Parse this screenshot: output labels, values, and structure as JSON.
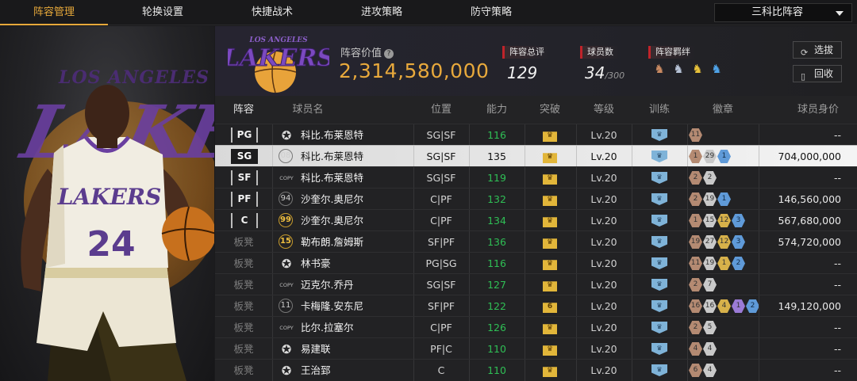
{
  "tabs": [
    "阵容管理",
    "轮换设置",
    "快捷战术",
    "进攻策略",
    "防守策略"
  ],
  "lineup_select": "三科比阵容",
  "header": {
    "value_label": "阵容价值",
    "value": "2,314,580,000",
    "rating_label": "阵容总评",
    "rating": "129",
    "count_label": "球员数",
    "count": "34",
    "count_max": "/300",
    "bond_label": "阵容羁绊",
    "btn_select": "选拔",
    "btn_recycle": "回收"
  },
  "columns": [
    "阵容",
    "球员名",
    "位置",
    "能力",
    "突破",
    "等级",
    "训练",
    "徽章",
    "球员身价"
  ],
  "rows": [
    {
      "slot": "PG",
      "mark": "star",
      "name": "科比.布莱恩特",
      "pos": "SG|SF",
      "ability": "116",
      "breakthrough": "",
      "level": "Lv.20",
      "badges": [
        {
          "c": "bronze",
          "t": "11"
        }
      ],
      "worth": "--"
    },
    {
      "slot": "SG",
      "mark": "08",
      "name": "科比.布莱恩特",
      "pos": "SG|SF",
      "ability": "135",
      "breakthrough": "",
      "level": "Lv.20",
      "badges": [
        {
          "c": "bronze",
          "t": "1"
        },
        {
          "c": "silver",
          "t": "29"
        },
        {
          "c": "blue",
          "t": "1"
        }
      ],
      "worth": "704,000,000",
      "selected": true
    },
    {
      "slot": "SF",
      "mark": "COPY",
      "name": "科比.布莱恩特",
      "pos": "SG|SF",
      "ability": "119",
      "breakthrough": "",
      "level": "Lv.20",
      "badges": [
        {
          "c": "bronze",
          "t": "2"
        },
        {
          "c": "silver",
          "t": "2"
        }
      ],
      "worth": "--"
    },
    {
      "slot": "PF",
      "mark": "94",
      "name": "沙奎尔.奥尼尔",
      "pos": "C|PF",
      "ability": "132",
      "breakthrough": "",
      "level": "Lv.20",
      "badges": [
        {
          "c": "bronze",
          "t": "2"
        },
        {
          "c": "silver",
          "t": "19"
        },
        {
          "c": "blue",
          "t": "1"
        }
      ],
      "worth": "146,560,000"
    },
    {
      "slot": "C",
      "mark": "99",
      "name": "沙奎尔.奥尼尔",
      "pos": "C|PF",
      "ability": "134",
      "breakthrough": "",
      "level": "Lv.20",
      "badges": [
        {
          "c": "bronze",
          "t": "1"
        },
        {
          "c": "silver",
          "t": "15"
        },
        {
          "c": "gold",
          "t": "12"
        },
        {
          "c": "blue",
          "t": "3"
        }
      ],
      "worth": "567,680,000"
    },
    {
      "slot": "板凳",
      "mark": "15",
      "name": "勒布朗.詹姆斯",
      "pos": "SF|PF",
      "ability": "136",
      "breakthrough": "",
      "level": "Lv.20",
      "badges": [
        {
          "c": "bronze",
          "t": "19"
        },
        {
          "c": "silver",
          "t": "27"
        },
        {
          "c": "gold",
          "t": "12"
        },
        {
          "c": "blue",
          "t": "3"
        }
      ],
      "worth": "574,720,000"
    },
    {
      "slot": "板凳",
      "mark": "star",
      "name": "林书豪",
      "pos": "PG|SG",
      "ability": "116",
      "breakthrough": "",
      "level": "Lv.20",
      "badges": [
        {
          "c": "bronze",
          "t": "11"
        },
        {
          "c": "silver",
          "t": "19"
        },
        {
          "c": "gold",
          "t": "1"
        },
        {
          "c": "blue",
          "t": "2"
        }
      ],
      "worth": "--"
    },
    {
      "slot": "板凳",
      "mark": "COPY",
      "name": "迈克尔.乔丹",
      "pos": "SG|SF",
      "ability": "127",
      "breakthrough": "",
      "level": "Lv.20",
      "badges": [
        {
          "c": "bronze",
          "t": "2"
        },
        {
          "c": "silver",
          "t": "7"
        }
      ],
      "worth": "--"
    },
    {
      "slot": "板凳",
      "mark": "11",
      "name": "卡梅隆.安东尼",
      "pos": "SF|PF",
      "ability": "122",
      "breakthrough": "6",
      "level": "Lv.20",
      "badges": [
        {
          "c": "bronze",
          "t": "16"
        },
        {
          "c": "silver",
          "t": "16"
        },
        {
          "c": "gold",
          "t": "4"
        },
        {
          "c": "purple",
          "t": "1"
        },
        {
          "c": "blue",
          "t": "2"
        }
      ],
      "worth": "149,120,000"
    },
    {
      "slot": "板凳",
      "mark": "COPY",
      "name": "比尔.拉塞尔",
      "pos": "C|PF",
      "ability": "126",
      "breakthrough": "",
      "level": "Lv.20",
      "badges": [
        {
          "c": "bronze",
          "t": "2"
        },
        {
          "c": "silver",
          "t": "5"
        }
      ],
      "worth": "--"
    },
    {
      "slot": "板凳",
      "mark": "star",
      "name": "易建联",
      "pos": "PF|C",
      "ability": "110",
      "breakthrough": "",
      "level": "Lv.20",
      "badges": [
        {
          "c": "bronze",
          "t": "4"
        },
        {
          "c": "silver",
          "t": "4"
        }
      ],
      "worth": "--"
    },
    {
      "slot": "板凳",
      "mark": "star",
      "name": "王治郅",
      "pos": "C",
      "ability": "110",
      "breakthrough": "",
      "level": "Lv.20",
      "badges": [
        {
          "c": "bronze",
          "t": "6"
        },
        {
          "c": "silver",
          "t": "4"
        }
      ],
      "worth": "--"
    }
  ],
  "colors": {
    "accent": "#e6a83a",
    "ability": "#2fbf55",
    "value": "#e8a93c",
    "tag_red": "#c0232a",
    "lakers_purple": "#6a3fa0"
  },
  "logo_text": "LAKERS",
  "logo_arc_text": "LOS ANGELES",
  "hero_jersey_number": "24"
}
